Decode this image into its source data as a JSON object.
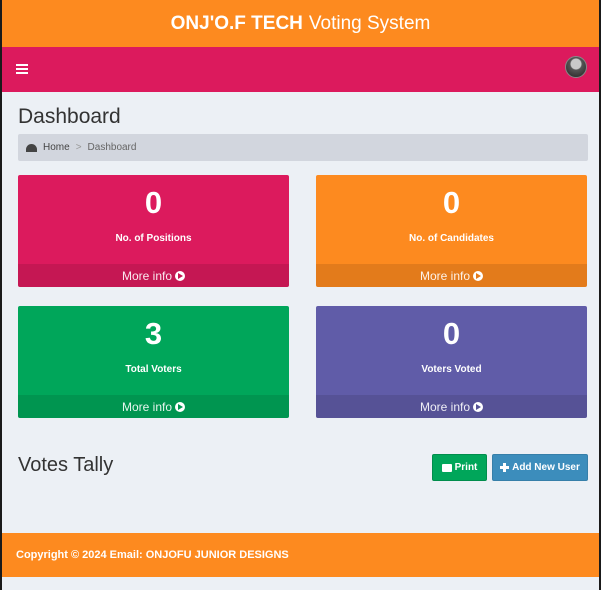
{
  "header": {
    "brand_bold": "ONJ'O.F TECH",
    "brand_rest": "Voting System"
  },
  "navbar": {
    "menu_icon": "bars-icon",
    "avatar_icon": "user-avatar"
  },
  "page": {
    "title": "Dashboard",
    "breadcrumb": {
      "icon": "dashboard-icon",
      "home": "Home",
      "separator": ">",
      "current": "Dashboard"
    }
  },
  "stats": [
    {
      "value": "0",
      "label": "No. of Positions",
      "more": "More info",
      "color": "#dc1a5d"
    },
    {
      "value": "0",
      "label": "No. of Candidates",
      "more": "More info",
      "color": "#fd8a1f"
    },
    {
      "value": "3",
      "label": "Total Voters",
      "more": "More info",
      "color": "#00a65a"
    },
    {
      "value": "0",
      "label": "Voters Voted",
      "more": "More info",
      "color": "#605ca8"
    }
  ],
  "tally": {
    "title": "Votes Tally",
    "print_label": "Print",
    "add_user_label": "Add New User"
  },
  "footer": {
    "text": "Copyright © 2024 Email: ONJOFU JUNIOR DESIGNS"
  },
  "colors": {
    "accent_orange": "#fd8a1f",
    "accent_pink": "#dc1a5d",
    "green": "#00a65a",
    "purple": "#605ca8",
    "blue": "#3c8dbc"
  }
}
